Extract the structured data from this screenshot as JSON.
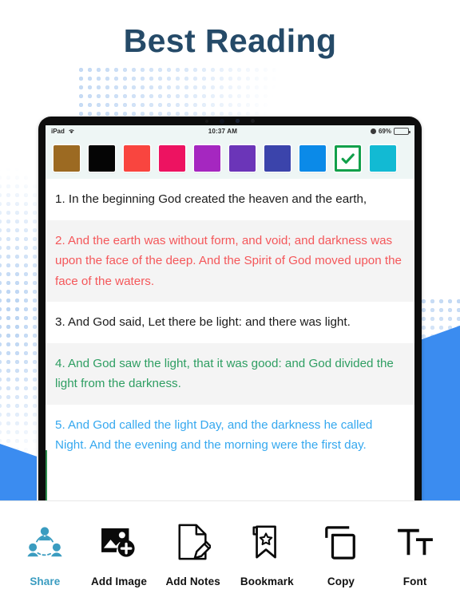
{
  "page": {
    "title": "Best Reading",
    "title_color": "#254a68",
    "accent_blue": "#3b8cf0"
  },
  "device": {
    "status_bar": {
      "carrier": "iPad",
      "wifi_icon": "wifi-icon",
      "time": "10:37 AM",
      "lock_icon": "rotation-lock-icon",
      "battery_percent": "69%",
      "battery_level": 69,
      "battery_color": "#39d24a"
    }
  },
  "palette": {
    "swatches": [
      {
        "name": "brown",
        "color": "#9c6a22",
        "selected": false
      },
      {
        "name": "black",
        "color": "#050505",
        "selected": false
      },
      {
        "name": "red",
        "color": "#f9453f",
        "selected": false
      },
      {
        "name": "pink",
        "color": "#ed1361",
        "selected": false
      },
      {
        "name": "magenta",
        "color": "#a527c0",
        "selected": false
      },
      {
        "name": "purple",
        "color": "#6b35b8",
        "selected": false
      },
      {
        "name": "indigo",
        "color": "#3b44ab",
        "selected": false
      },
      {
        "name": "blue",
        "color": "#0b8ae8",
        "selected": false
      },
      {
        "name": "green-check",
        "color": "#12a04b",
        "selected": true
      },
      {
        "name": "cyan",
        "color": "#12bad3",
        "selected": false
      }
    ],
    "selected_index": 8,
    "check_color": "#12a04b"
  },
  "reader": {
    "verses": [
      {
        "number": "1",
        "text": "1. In the beginning God created the heaven and the earth,",
        "highlight": "none",
        "shaded": false
      },
      {
        "number": "2",
        "text": "2. And the earth was without form, and void; and darkness was upon the face of the deep. And the Spirit of God moved upon the face of the waters.",
        "highlight": "red",
        "shaded": true
      },
      {
        "number": "3",
        "text": "3. And God said, Let there be light: and there was light.",
        "highlight": "none",
        "shaded": false
      },
      {
        "number": "4",
        "text": "4. And God saw the light, that it was good: and God divided the light from the darkness.",
        "highlight": "green",
        "shaded": true
      },
      {
        "number": "5",
        "text": "5. And God called the light Day, and the darkness he called Night. And the evening and the morning were the first day.",
        "highlight": "blue",
        "shaded": false
      }
    ],
    "highlight_colors": {
      "red": "#f4575a",
      "green": "#2e9e62",
      "blue": "#35a8ef",
      "none": "#1b1b1b"
    }
  },
  "toolbar": {
    "active_color": "#3a9cc0",
    "items": [
      {
        "label": "Share",
        "icon": "share-people-icon",
        "active": true
      },
      {
        "label": "Add Image",
        "icon": "add-image-icon",
        "active": false
      },
      {
        "label": "Add Notes",
        "icon": "add-notes-icon",
        "active": false
      },
      {
        "label": "Bookmark",
        "icon": "bookmark-star-icon",
        "active": false
      },
      {
        "label": "Copy",
        "icon": "copy-icon",
        "active": false
      },
      {
        "label": "Font",
        "icon": "font-size-icon",
        "active": false
      }
    ]
  }
}
